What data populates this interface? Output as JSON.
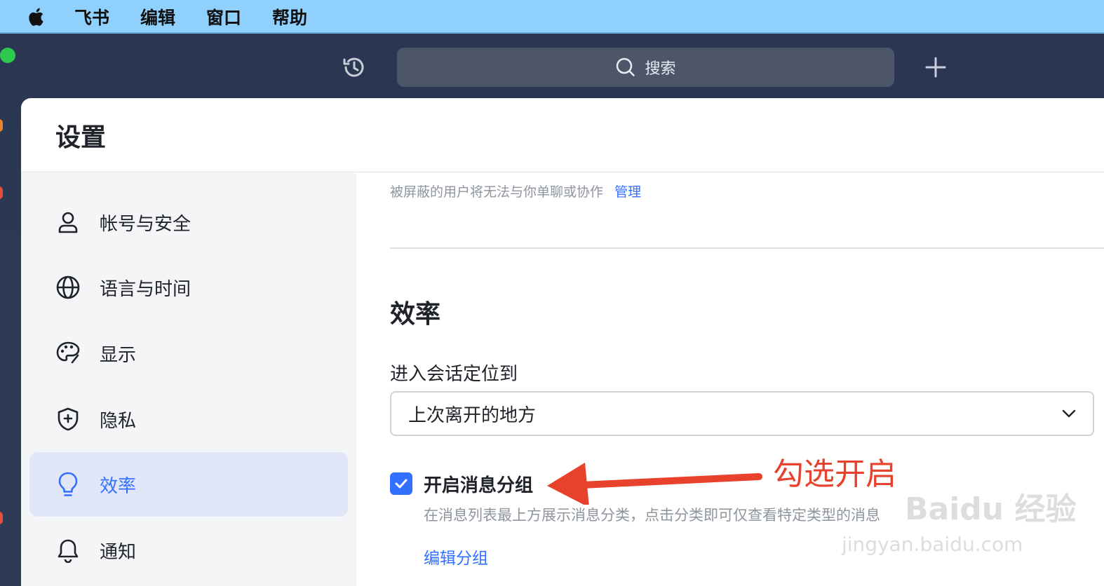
{
  "menubar": {
    "items": [
      "飞书",
      "编辑",
      "窗口",
      "帮助"
    ]
  },
  "toolbar": {
    "search_placeholder": "搜索"
  },
  "settings": {
    "title": "设置",
    "nav": [
      {
        "label": "帐号与安全",
        "icon": "user-icon"
      },
      {
        "label": "语言与时间",
        "icon": "globe-icon"
      },
      {
        "label": "显示",
        "icon": "palette-icon"
      },
      {
        "label": "隐私",
        "icon": "shield-plus-icon"
      },
      {
        "label": "效率",
        "icon": "lightbulb-icon",
        "active": true
      },
      {
        "label": "通知",
        "icon": "bell-icon"
      }
    ],
    "content": {
      "blocked_note": "被屏蔽的用户将无法与你单聊或协作",
      "manage_link": "管理",
      "section_title": "效率",
      "locate_label": "进入会话定位到",
      "locate_value": "上次离开的地方",
      "group_checkbox_label": "开启消息分组",
      "group_checkbox_checked": true,
      "group_desc": "在消息列表最上方展示消息分类，点击分类即可仅查看特定类型的消息",
      "edit_group_link": "编辑分组"
    }
  },
  "annotation": {
    "text": "勾选开启",
    "color": "#e8412c"
  },
  "watermark": {
    "line1": "Baidu 经验",
    "line2": "jingyan.baidu.com"
  },
  "colors": {
    "accent": "#3370ff",
    "menubar": "#8fd0fd",
    "app_bg": "#2b3550"
  }
}
